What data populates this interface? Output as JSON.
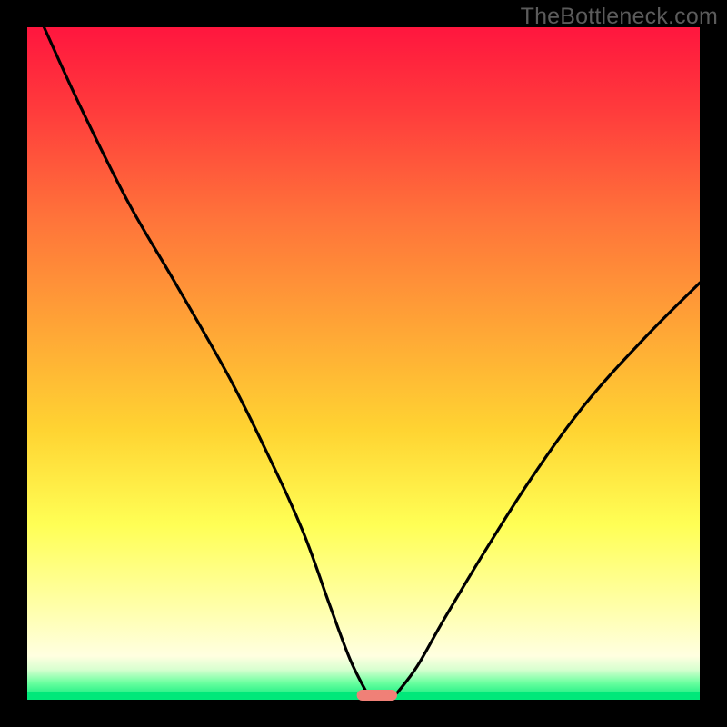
{
  "watermark": "TheBottleneck.com",
  "chart_data": {
    "type": "line",
    "title": "",
    "xlabel": "",
    "ylabel": "",
    "xlim": [
      0,
      100
    ],
    "ylim": [
      0,
      100
    ],
    "grid": false,
    "legend": false,
    "background_gradient": [
      "#ff173e",
      "#ff6f3a",
      "#ffd633",
      "#ffff6a",
      "#ffffc5",
      "#ffffe6",
      "#6aff9f",
      "#00e87a"
    ],
    "series": [
      {
        "name": "bottleneck-curve-left",
        "x": [
          2.5,
          8,
          15,
          22,
          30,
          36,
          41,
          45,
          48,
          50.5
        ],
        "values": [
          100,
          88,
          74,
          62,
          48,
          36,
          25,
          14,
          6,
          1
        ]
      },
      {
        "name": "bottleneck-curve-right",
        "x": [
          55,
          58,
          62,
          68,
          75,
          83,
          92,
          100
        ],
        "values": [
          1,
          5,
          12,
          22,
          33,
          44,
          54,
          62
        ]
      }
    ],
    "marker": {
      "name": "sweet-spot",
      "x_center": 52,
      "x_width": 6,
      "color": "#f08077"
    }
  },
  "plot_geometry": {
    "inner_left": 30,
    "inner_top": 30,
    "inner_width": 740,
    "inner_height": 740,
    "green_band_top_frac": 0.965,
    "curve_stroke": "#000000",
    "curve_width": 3.2
  }
}
